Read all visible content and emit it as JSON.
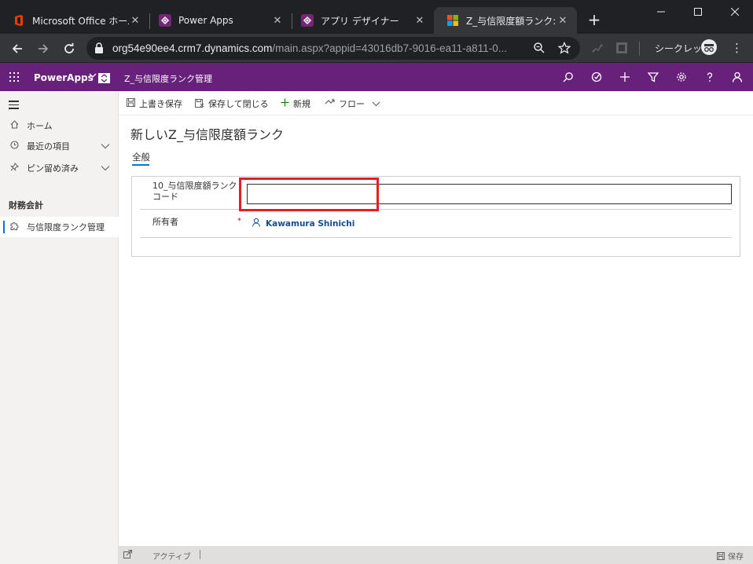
{
  "browser": {
    "tabs": [
      {
        "title": "Microsoft Office ホーム",
        "favicon": "office-icon"
      },
      {
        "title": "Power Apps",
        "favicon": "powerapps-icon"
      },
      {
        "title": "アプリ デザイナー",
        "favicon": "powerapps-icon"
      },
      {
        "title": "Z_与信限度額ランク: 情",
        "favicon": "microsoft-icon"
      }
    ],
    "active_tab": 3,
    "url_host": "org54e90ee4.crm7.dynamics.com",
    "url_path": "/main.aspx?appid=43016db7-9016-ea11-a811-0...",
    "incognito_label": "シークレット"
  },
  "header": {
    "app_name": "PowerApps",
    "area_name": "Z_与信限度ランク管理"
  },
  "nav": {
    "home": "ホーム",
    "recent": "最近の項目",
    "pinned": "ピン留め済み",
    "section": "財務会計",
    "entity": "与信限度ランク管理"
  },
  "commands": {
    "save": "上書き保存",
    "save_close": "保存して閉じる",
    "new": "新規",
    "flow": "フロー"
  },
  "form": {
    "title": "新しいZ_与信限度額ランク",
    "tab": "全般",
    "field1_label_line1": "10_与信限度額ランク",
    "field1_label_line2": "コード",
    "field1_value": "",
    "owner_label": "所有者",
    "owner_required": "*",
    "owner_value": "Kawamura Shinichi"
  },
  "footer": {
    "status": "アクティブ",
    "save": "保存"
  },
  "colors": {
    "header_bg": "#68217a",
    "highlight": "#e51e25",
    "accent": "#0078d4"
  }
}
